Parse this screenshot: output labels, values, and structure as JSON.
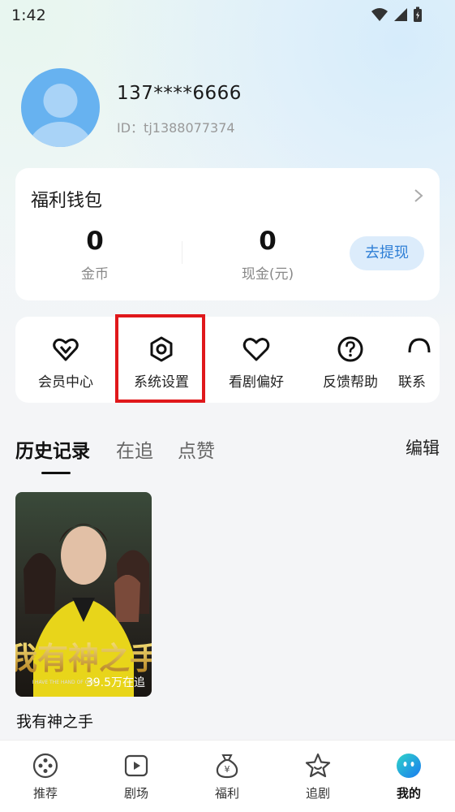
{
  "status_bar": {
    "time": "1:42"
  },
  "profile": {
    "phone": "137****6666",
    "user_id": "ID：tj1388077374"
  },
  "wallet": {
    "title": "福利钱包",
    "coins_value": "0",
    "coins_label": "金币",
    "cash_value": "0",
    "cash_label": "现金(元)",
    "withdraw_label": "去提现"
  },
  "shortcuts": [
    {
      "label": "会员中心",
      "icon": "vip-heart-icon"
    },
    {
      "label": "系统设置",
      "icon": "settings-hexagon-icon"
    },
    {
      "label": "看剧偏好",
      "icon": "heart-icon"
    },
    {
      "label": "反馈帮助",
      "icon": "question-icon"
    },
    {
      "label": "联系",
      "icon": "headset-icon"
    }
  ],
  "history_tabs": {
    "tab1": "历史记录",
    "tab2": "在追",
    "tab3": "点赞",
    "edit": "编辑"
  },
  "history_items": [
    {
      "title": "我有神之手",
      "followers": "39.5万在追",
      "poster_title": "我有神之手",
      "poster_subtitle": "I HAVE THE HAND OF GOD"
    }
  ],
  "bottom_nav": [
    {
      "label": "推荐",
      "icon": "recommend-icon"
    },
    {
      "label": "剧场",
      "icon": "theater-play-icon"
    },
    {
      "label": "福利",
      "icon": "money-bag-icon"
    },
    {
      "label": "追剧",
      "icon": "star-icon"
    },
    {
      "label": "我的",
      "icon": "profile-face-icon",
      "active": true
    }
  ],
  "colors": {
    "accent_blue": "#2f7fd6",
    "highlight_red": "#e0181b",
    "avatar_blue": "#67b2f0"
  }
}
